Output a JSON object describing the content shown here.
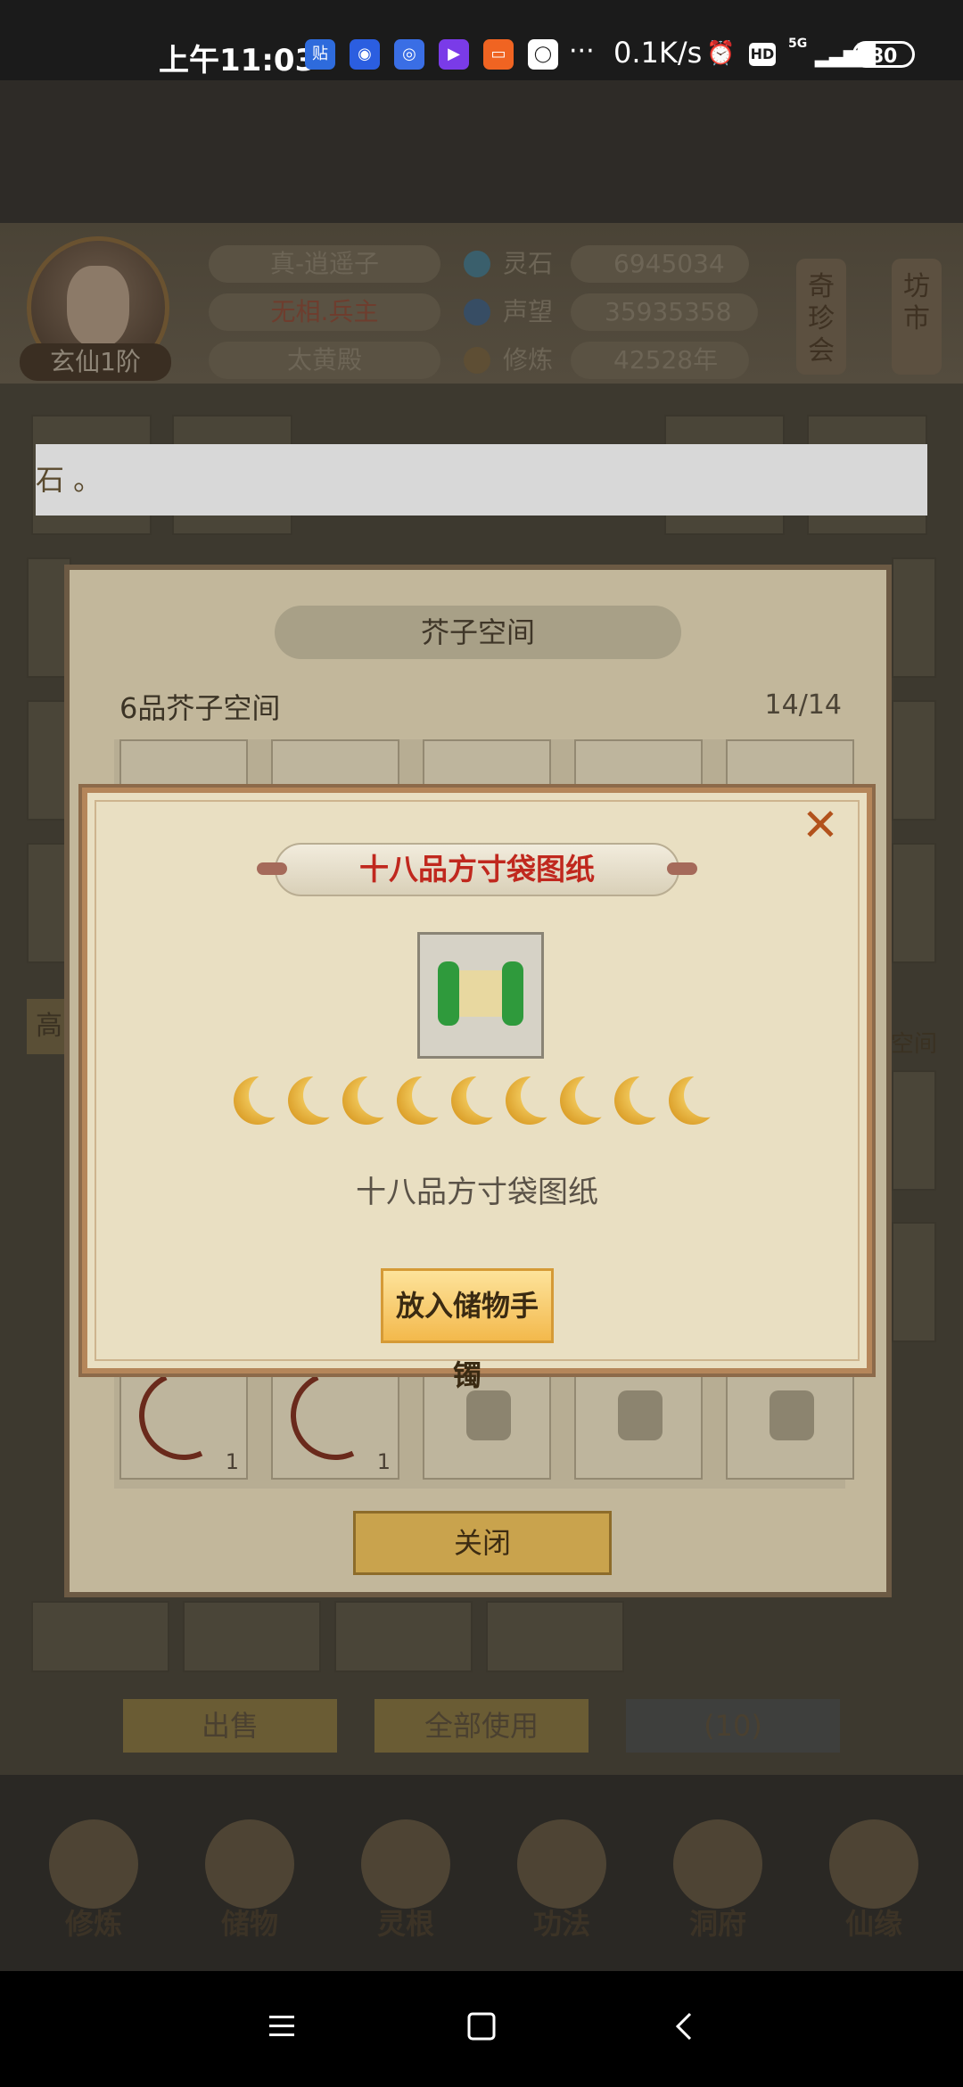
{
  "status_bar": {
    "time": "上午11:03",
    "app_icons": [
      {
        "name": "tieba-icon",
        "glyph": "贴",
        "color": "#2e6bdc"
      },
      {
        "name": "baidu-icon",
        "glyph": "◉",
        "color": "#2b5ee0"
      },
      {
        "name": "baidu-app-icon",
        "glyph": "◎",
        "color": "#3a6ee5"
      },
      {
        "name": "video-icon",
        "glyph": "▶",
        "color": "#7a3be8"
      },
      {
        "name": "youku-icon",
        "glyph": "▭",
        "color": "#f06422"
      },
      {
        "name": "browser-icon",
        "glyph": "◯",
        "color": "#ffffff"
      }
    ],
    "dots": "···",
    "speed": "0.1K/s",
    "hd": "HD",
    "network": "5G",
    "battery": "80"
  },
  "profile": {
    "name": "真-逍遥子",
    "title": "无相.兵主",
    "faction": "太黄殿",
    "rank": "玄仙1阶",
    "stats": [
      {
        "label": "灵石",
        "value": "6945034",
        "icon": "spirit-stone-icon",
        "color": "#3a8fb0"
      },
      {
        "label": "声望",
        "value": "35935358",
        "icon": "reputation-icon",
        "color": "#3a6ea8"
      },
      {
        "label": "修炼",
        "value": "42528年",
        "icon": "cultivation-icon",
        "color": "#b08a3a"
      }
    ],
    "banners": [
      "奇珍会",
      "坊市"
    ]
  },
  "toast": {
    "text": "石 。"
  },
  "storage_panel": {
    "title": "芥子空间",
    "subtitle": "6品芥子空间",
    "count": "14/14",
    "close_label": "关闭",
    "bottom_row": [
      {
        "item": "bow",
        "qty": "1"
      },
      {
        "item": "bow",
        "qty": "1"
      },
      {
        "item": "locked",
        "qty": ""
      },
      {
        "item": "locked",
        "qty": ""
      },
      {
        "item": "locked",
        "qty": ""
      }
    ]
  },
  "side_labels": {
    "left": "高",
    "right": "空间"
  },
  "actions": {
    "sell": "出售",
    "use_all": "全部使用",
    "count": "(10)"
  },
  "tabs": [
    "修炼",
    "储物",
    "灵根",
    "功法",
    "洞府",
    "仙缘"
  ],
  "dialog": {
    "title": "十八品方寸袋图纸",
    "item_name": "十八品方寸袋图纸",
    "moon_count": 9,
    "put_button": "放入储物手镯",
    "close_glyph": "✕"
  }
}
